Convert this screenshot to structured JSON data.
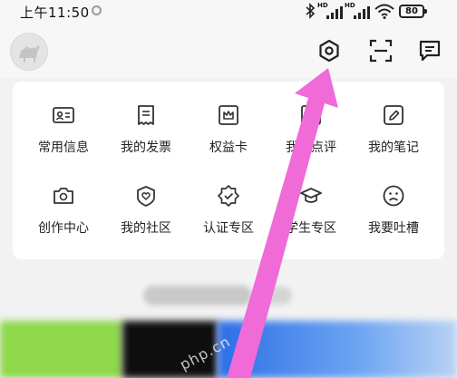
{
  "status_bar": {
    "time": "上午11:50",
    "sync_icon": "sync-icon",
    "network_label_1": "HD",
    "network_label_2": "HD",
    "battery_level": "80"
  },
  "topbar": {
    "avatar_icon": "camel-avatar",
    "icons": [
      "settings-hexagon-icon",
      "scan-icon",
      "message-icon"
    ]
  },
  "grid": {
    "items": [
      {
        "label": "常用信息",
        "icon": "id-card-icon"
      },
      {
        "label": "我的发票",
        "icon": "receipt-icon"
      },
      {
        "label": "权益卡",
        "icon": "crown-card-icon"
      },
      {
        "label": "我的点评",
        "icon": "review-icon"
      },
      {
        "label": "我的笔记",
        "icon": "pen-note-icon"
      },
      {
        "label": "创作中心",
        "icon": "camera-icon"
      },
      {
        "label": "我的社区",
        "icon": "community-icon"
      },
      {
        "label": "认证专区",
        "icon": "verified-badge-icon"
      },
      {
        "label": "学生专区",
        "icon": "graduation-cap-icon"
      },
      {
        "label": "我要吐槽",
        "icon": "sad-face-icon"
      }
    ]
  },
  "watermark": "php.cn",
  "colors": {
    "annotation_arrow": "#f06ad8",
    "banner_green": "#8ed84a",
    "banner_blue": "#2c6fe6"
  }
}
